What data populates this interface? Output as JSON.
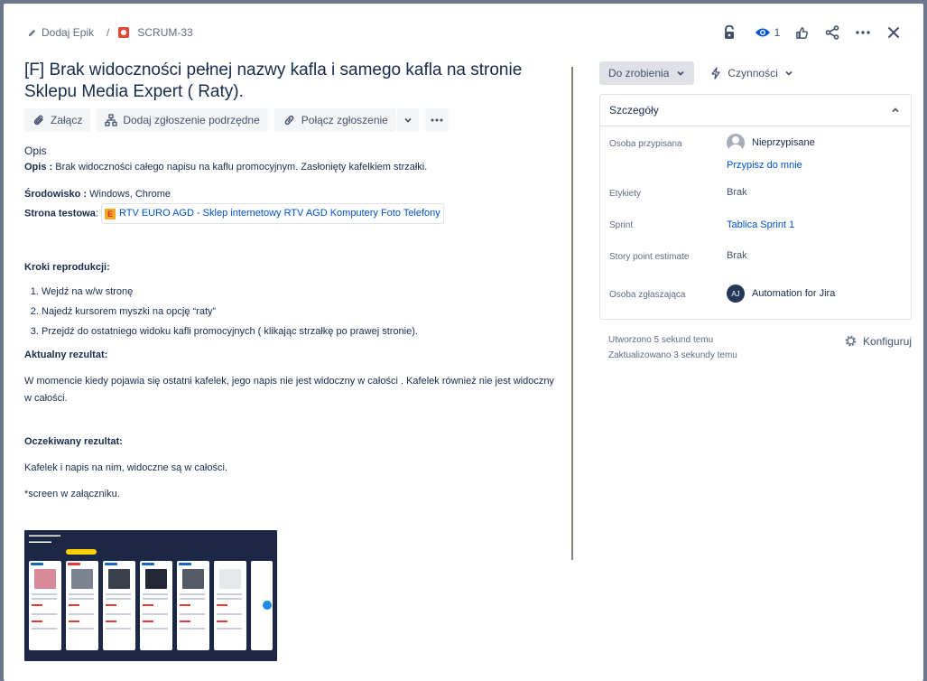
{
  "breadcrumb": {
    "epic_label": "Dodaj Epik",
    "separator": "/",
    "issue_key": "SCRUM-33"
  },
  "header": {
    "watch_count": "1"
  },
  "issue": {
    "title": "[F] Brak widoczności pełnej nazwy kafla i samego kafla na stronie Sklepu Media Expert ( Raty)."
  },
  "toolbar": {
    "attach": "Załącz",
    "add_child": "Dodaj zgłoszenie podrzędne",
    "link_issue": "Połącz zgłoszenie"
  },
  "description": {
    "label": "Opis",
    "opis_key": "Opis :",
    "opis_value": " Brak widoczności całego napisu na kaflu promocyjnym. Zasłonięty kafelkiem strzałki.",
    "env_key": "Środowisko :",
    "env_value": " Windows, Chrome",
    "test_page_key": "Strona testowa",
    "test_page_sep": ":",
    "test_page_link": "RTV EURO AGD - Sklep internetowy RTV AGD Komputery Foto Telefony",
    "steps_title": "Kroki reprodukcji:",
    "steps": [
      "Wejdź na w/w stronę",
      "Najedź kursorem myszki na opcję “raty”",
      "Przejdź do ostatniego widoku kafli promocyjnych ( klikając strzałkę po prawej stronie)."
    ],
    "actual_title": "Aktualny rezultat:",
    "actual_text": "W momencie kiedy pojawia się ostatni kafelek, jego napis nie jest widoczny w całości . Kafelek również nie jest widoczny w całości.",
    "expected_title": "Oczekiwany rezultat:",
    "expected_text": "Kafelek i napis na nim, widoczne są w całości.",
    "screen_note": "*screen w załączniku."
  },
  "status": {
    "label": "Do zrobienia",
    "actions": "Czynności"
  },
  "details": {
    "title": "Szczegóły",
    "assignee_label": "Osoba przypisana",
    "assignee_value": "Nieprzypisane",
    "assign_me": "Przypisz do mnie",
    "labels_label": "Etykiety",
    "labels_value": "Brak",
    "sprint_label": "Sprint",
    "sprint_value": "Tablica Sprint 1",
    "sp_label": "Story point estimate",
    "sp_value": "Brak",
    "reporter_label": "Osoba zgłaszająca",
    "reporter_initials": "AJ",
    "reporter_value": "Automation for Jira"
  },
  "meta": {
    "created": "Utworzono 5 sekund temu",
    "updated": "Zaktualizowano 3 sekundy temu",
    "configure": "Konfiguruj"
  }
}
